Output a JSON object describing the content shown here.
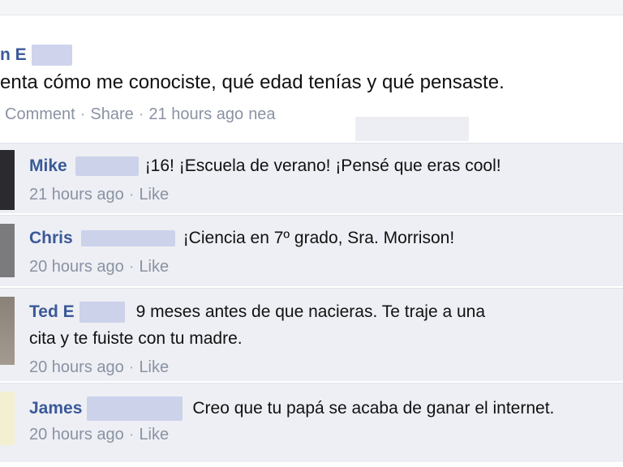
{
  "post": {
    "author_visible": "n E",
    "text": "enta cómo me conociste, qué edad tenías y qué pensaste.",
    "actions": {
      "comment": "Comment",
      "share": "Share"
    },
    "time": "21 hours ago",
    "location_prefix": "nea"
  },
  "comments": [
    {
      "name": "Mike",
      "text": "¡16! ¡Escuela de verano! ¡Pensé que eras cool!",
      "time": "21 hours ago",
      "like": "Like"
    },
    {
      "name": "Chris",
      "text": "¡Ciencia en 7º grado, Sra. Morrison!",
      "time": "20 hours ago",
      "like": "Like"
    },
    {
      "name": "Ted E",
      "text_line1": "9 meses antes de que nacieras. Te traje a una",
      "text_line2": "cita y te fuiste con tu madre.",
      "time": "20 hours ago",
      "like": "Like"
    },
    {
      "name": "James",
      "text": "Creo que tu papá se acaba de ganar el internet.",
      "time": "20 hours ago",
      "like": "Like"
    }
  ],
  "separator": "·",
  "colors": {
    "link": "#3b5998",
    "comment_bg": "#edeff4",
    "meta": "#8a92a3"
  }
}
